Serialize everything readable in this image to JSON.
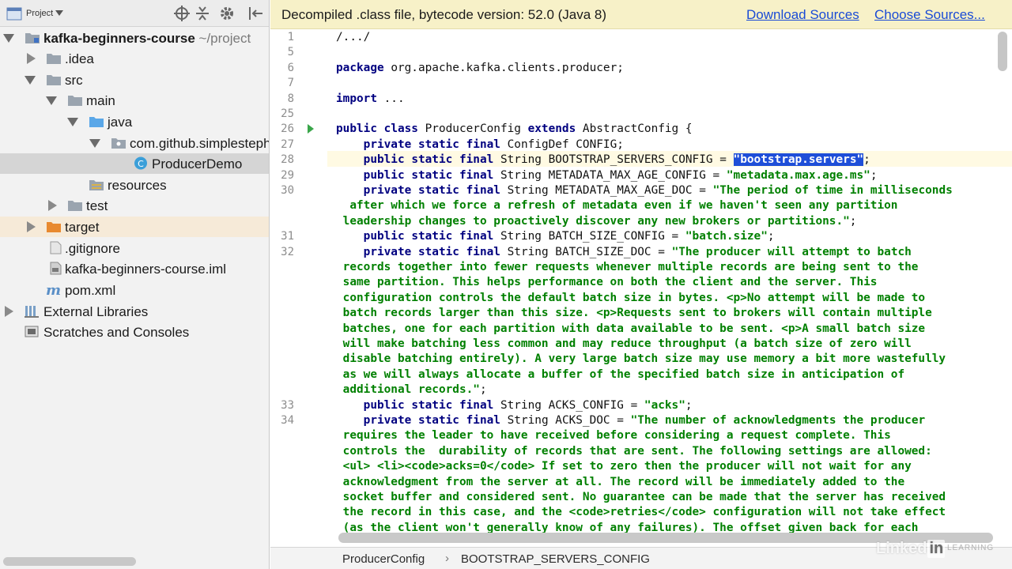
{
  "project_panel": {
    "tab_label": "Project",
    "tree": [
      {
        "label": "kafka-beginners-course",
        "suffix": " ~/project",
        "icon": "module-folder-icon",
        "expanded": true
      },
      {
        "label": ".idea",
        "icon": "folder-icon",
        "expanded": false
      },
      {
        "label": "src",
        "icon": "folder-icon",
        "expanded": true
      },
      {
        "label": "main",
        "icon": "folder-icon",
        "expanded": true
      },
      {
        "label": "java",
        "icon": "source-folder-icon",
        "expanded": true
      },
      {
        "label": "com.github.simplesteph",
        "icon": "package-icon",
        "expanded": true
      },
      {
        "label": "ProducerDemo",
        "icon": "class-icon",
        "selected": true
      },
      {
        "label": "resources",
        "icon": "resources-folder-icon"
      },
      {
        "label": "test",
        "icon": "folder-icon",
        "expanded": false
      },
      {
        "label": "target",
        "icon": "excluded-folder-icon",
        "expanded": false
      },
      {
        "label": ".gitignore",
        "icon": "file-icon"
      },
      {
        "label": "kafka-beginners-course.iml",
        "icon": "iml-file-icon"
      },
      {
        "label": "pom.xml",
        "icon": "maven-icon"
      },
      {
        "label": "External Libraries",
        "icon": "libraries-icon",
        "expanded": false
      },
      {
        "label": "Scratches and Consoles",
        "icon": "scratches-icon"
      }
    ]
  },
  "banner": {
    "text": "Decompiled .class file, bytecode version: 52.0 (Java 8)",
    "download_sources": "Download Sources",
    "choose_sources": "Choose Sources..."
  },
  "editor": {
    "line_numbers": [
      "1",
      "5",
      "6",
      "7",
      "8",
      "25",
      "26",
      "27",
      "28",
      "29",
      "30",
      "",
      "",
      "31",
      "32",
      "",
      "",
      "",
      "",
      "",
      "",
      "",
      "",
      "",
      "33",
      "34",
      "",
      "",
      "",
      "",
      "",
      ""
    ],
    "lines": [
      "/.../",
      "",
      "package org.apache.kafka.clients.producer;",
      "",
      "import ...",
      "",
      "public class ProducerConfig extends AbstractConfig {",
      "    private static final ConfigDef CONFIG;",
      "    public static final String BOOTSTRAP_SERVERS_CONFIG = \"bootstrap.servers\";",
      "    public static final String METADATA_MAX_AGE_CONFIG = \"metadata.max.age.ms\";",
      "    private static final String METADATA_MAX_AGE_DOC = \"The period of time in milliseconds",
      "  after which we force a refresh of metadata even if we haven't seen any partition",
      " leadership changes to proactively discover any new brokers or partitions.\";",
      "    public static final String BATCH_SIZE_CONFIG = \"batch.size\";",
      "    private static final String BATCH_SIZE_DOC = \"The producer will attempt to batch",
      " records together into fewer requests whenever multiple records are being sent to the",
      " same partition. This helps performance on both the client and the server. This",
      " configuration controls the default batch size in bytes. <p>No attempt will be made to",
      " batch records larger than this size. <p>Requests sent to brokers will contain multiple",
      " batches, one for each partition with data available to be sent. <p>A small batch size",
      " will make batching less common and may reduce throughput (a batch size of zero will",
      " disable batching entirely). A very large batch size may use memory a bit more wastefully",
      " as we will always allocate a buffer of the specified batch size in anticipation of",
      " additional records.\";",
      "    public static final String ACKS_CONFIG = \"acks\";",
      "    private static final String ACKS_DOC = \"The number of acknowledgments the producer",
      " requires the leader to have received before considering a request complete. This",
      " controls the  durability of records that are sent. The following settings are allowed:",
      " <ul> <li><code>acks=0</code> If set to zero then the producer will not wait for any",
      " acknowledgment from the server at all. The record will be immediately added to the",
      " socket buffer and considered sent. No guarantee can be made that the server has received",
      " the record in this case, and the <code>retries</code> configuration will not take effect",
      " (as the client won't generally know of any failures). The offset given back for each"
    ]
  },
  "breadcrumb": {
    "class_name": "ProducerConfig",
    "separator": "›",
    "field_name": "BOOTSTRAP_SERVERS_CONFIG"
  },
  "watermark": {
    "brand": "Linked",
    "box": "in",
    "sub": "LEARNING"
  }
}
